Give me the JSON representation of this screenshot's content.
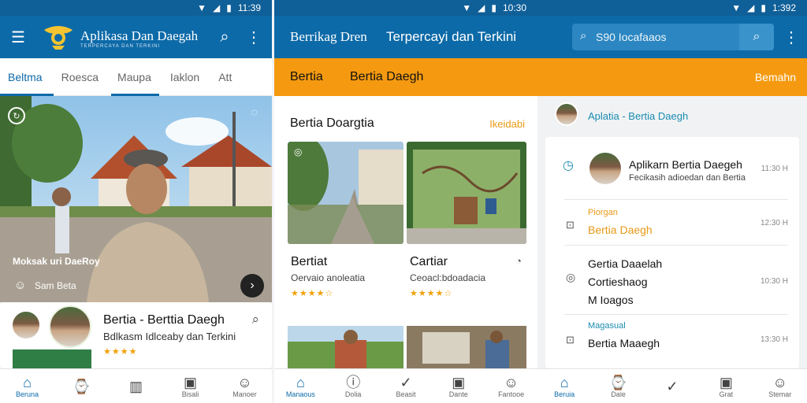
{
  "screens": [
    {
      "status_time": "11:39",
      "app_title": "Aplikasa Dan Daegah",
      "app_subtitle": "TERPERCAYA DAN TERKINI",
      "tabs": [
        "Beltma",
        "Roesca",
        "Maupa",
        "Iaklon",
        "Att"
      ],
      "hero_caption": "Moksak uri DaeRoy",
      "hero_author": "Sam Beta",
      "featured": {
        "title": "Bertia - Berttia Daegh",
        "subtitle": "Bdlkasm Idlceaby dan Terkini",
        "rating": "★★★★"
      },
      "nav": [
        {
          "label": "Beruna",
          "icon": "⌂"
        },
        {
          "label": "",
          "icon": "⌚"
        },
        {
          "label": "",
          "icon": "▥"
        },
        {
          "label": "Bisali",
          "icon": "▣"
        },
        {
          "label": "Manoer",
          "icon": "☺"
        }
      ]
    },
    {
      "status_time": "10:30",
      "header_left": "Berrikag Dren",
      "header_right": "Terpercayi dan Terkini",
      "orange_tabs": [
        "Bertia",
        "Bertia Daegh"
      ],
      "section_title": "Bertia Doargtia",
      "section_action": "Ikeidabi",
      "cards": [
        {
          "title": "Bertiat",
          "subtitle": "Oervaio anoleatia",
          "rating": "★★★★☆"
        },
        {
          "title": "Cartiar",
          "subtitle": "Ceoacl:bdoadacia",
          "rating": "★★★★☆"
        }
      ],
      "nav": [
        {
          "label": "Manaous",
          "icon": "⌂"
        },
        {
          "label": "Dolia",
          "icon": "ⓘ"
        },
        {
          "label": "Beasit",
          "icon": "✓"
        },
        {
          "label": "Dante",
          "icon": "▣"
        },
        {
          "label": "Fantooe",
          "icon": "☺"
        }
      ]
    },
    {
      "status_time": "1:392",
      "search_placeholder": "S90 Iocafaaos",
      "orange_action": "Bemahn",
      "profile_name": "Aplatia - Bertia Daegh",
      "list": [
        {
          "kicker": "",
          "title": "Aplikarn Bertia Daegeh",
          "subtitle": "Fecikasih adioedan dan Bertia",
          "time": "11:30 H"
        },
        {
          "kicker": "Piorgan",
          "title": "Bertia Daegh",
          "subtitle": "",
          "time": "12:30 H"
        },
        {
          "kicker": "",
          "title": "Gertia Daaelah\nCortieshaog\nM Ioagos",
          "subtitle": "",
          "time": "10:30 H"
        },
        {
          "kicker": "Magasual",
          "title": "Bertia Maaegh",
          "subtitle": "",
          "time": "13:30 H"
        }
      ],
      "nav": [
        {
          "label": "Beruia",
          "icon": "⌂"
        },
        {
          "label": "Dale",
          "icon": "⌚"
        },
        {
          "label": "",
          "icon": "✓"
        },
        {
          "label": "Grat",
          "icon": "▣"
        },
        {
          "label": "Stemar",
          "icon": "☺"
        }
      ]
    }
  ],
  "colors": {
    "primary": "#0d6aa8",
    "accent": "#f59a10",
    "star": "#f2a007"
  }
}
